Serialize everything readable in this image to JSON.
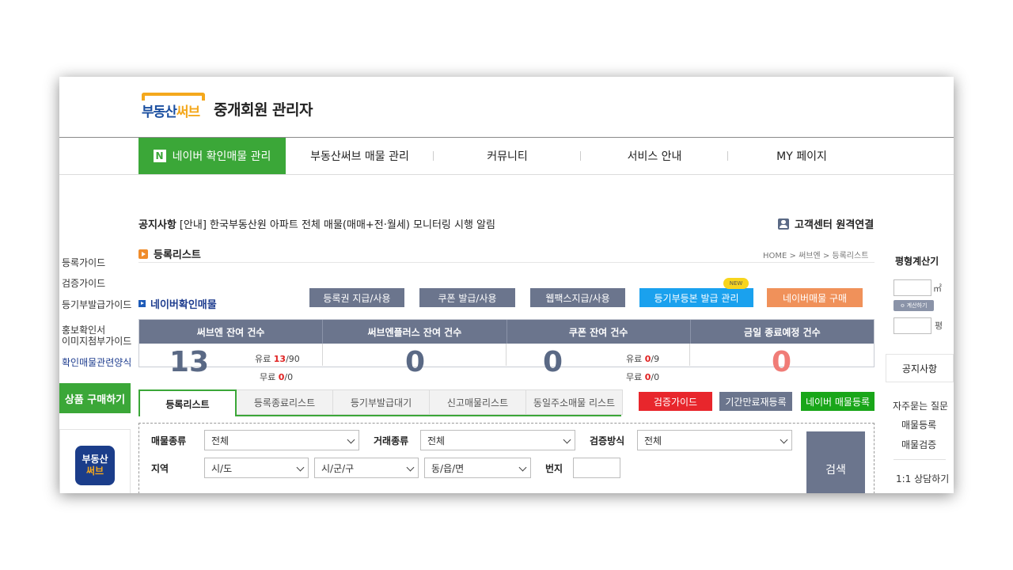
{
  "header": {
    "logo_part1": "부동산",
    "logo_part2": "써브",
    "title": "중개회원 관리자"
  },
  "nav": {
    "items": [
      {
        "label": "네이버 확인매물 관리",
        "badge": "N",
        "active": true
      },
      {
        "label": "부동산써브 매물 관리"
      },
      {
        "label": "커뮤니티"
      },
      {
        "label": "서비스 안내"
      },
      {
        "label": "MY 페이지"
      }
    ]
  },
  "notice": {
    "label": "공지사항",
    "text": "[안내] 한국부동산원 아파트 전체 매물(매매+전·월세) 모니터링 시행 알림"
  },
  "support_link": "고객센터 원격연결",
  "left_sidebar": {
    "links": [
      "등록가이드",
      "검증가이드",
      "등기부발급가이드",
      "홍보확인서",
      "이미지첨부가이드",
      "확인매물관련양식"
    ],
    "buy_button": "상품 구매하기",
    "app_icon_line1": "부동산",
    "app_icon_line2": "써브"
  },
  "section": {
    "title": "등록리스트",
    "breadcrumb": "HOME > 써브엔 > 등록리스트",
    "subtitle": "네이버확인매물"
  },
  "top_buttons": [
    {
      "label": "등록권 지급/사용",
      "color": "#6b758d"
    },
    {
      "label": "쿠폰 발급/사용",
      "color": "#6b758d"
    },
    {
      "label": "웹팩스지급/사용",
      "color": "#6b758d"
    },
    {
      "label": "등기부등본 발급 관리",
      "color": "#1aa1ee"
    },
    {
      "label": "네이버매물 구매",
      "color": "#f0915a"
    }
  ],
  "new_badge": "NEW",
  "stats": {
    "headers": [
      "써브엔 잔여 건수",
      "써브엔플러스 잔여 건수",
      "쿠폰 잔여 건수",
      "금일 종료예정 건수"
    ],
    "serve_total": "13",
    "serve_paid_label": "유료",
    "serve_paid_value": "13",
    "serve_paid_max": "/90",
    "serve_free_label": "무료",
    "serve_free_value": "0",
    "serve_free_max": "/0",
    "plus_total": "0",
    "coupon_total": "0",
    "coupon_paid_label": "유료",
    "coupon_paid_value": "0",
    "coupon_paid_max": "/9",
    "coupon_free_label": "무료",
    "coupon_free_value": "0",
    "coupon_free_max": "/0",
    "expiring_total": "0"
  },
  "tabs": [
    "등록리스트",
    "등록종료리스트",
    "등기부발급대기",
    "신고매물리스트",
    "동일주소매물 리스트"
  ],
  "tab_buttons": [
    {
      "label": "검증가이드",
      "color": "#e8262c"
    },
    {
      "label": "기간만료재등록",
      "color": "#6b758d"
    },
    {
      "label": "네이버 매물등록",
      "color": "#19a619"
    }
  ],
  "search": {
    "property_type_label": "매물종류",
    "property_type_value": "전체",
    "deal_type_label": "거래종류",
    "deal_type_value": "전체",
    "verify_label": "검증방식",
    "verify_value": "전체",
    "region_label": "지역",
    "sido": "시/도",
    "sigungu": "시/군/구",
    "dong": "동/읍/면",
    "lot_label": "번지",
    "search_button": "검색"
  },
  "right_sidebar": {
    "calc_title": "평형계산기",
    "unit_m2": "㎡",
    "calc_button": "≎ 계산하기",
    "unit_pyeong": "평",
    "notice": "공지사항",
    "links": [
      "자주묻는 질문",
      "매물등록",
      "매물검증",
      "1:1 상담하기"
    ]
  }
}
